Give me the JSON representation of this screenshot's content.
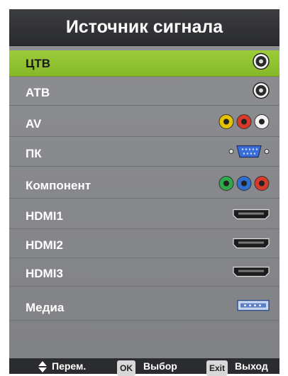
{
  "title": "Источник сигнала",
  "items": [
    {
      "label": "ЦТВ",
      "icon": "antenna-jack-icon",
      "selected": true
    },
    {
      "label": "АТВ",
      "icon": "antenna-jack-icon"
    },
    {
      "label": "AV",
      "icon": "rca-jacks-icon",
      "colors": [
        "#e6c200",
        "#d73a2a",
        "#f2f2f2"
      ]
    },
    {
      "label": "ПК",
      "icon": "vga-port-icon"
    },
    {
      "label": "Компонент",
      "icon": "component-jacks-icon",
      "colors": [
        "#2fa84a",
        "#2f6fd0",
        "#d73a2a"
      ]
    },
    {
      "label": "HDMI1",
      "icon": "hdmi-port-icon"
    },
    {
      "label": "HDMI2",
      "icon": "hdmi-port-icon"
    },
    {
      "label": "HDMI3",
      "icon": "hdmi-port-icon"
    },
    {
      "label": "Медиа",
      "icon": "usb-port-icon"
    }
  ],
  "footer": {
    "move_label": "Перем.",
    "ok_key": "OK",
    "select_label": "Выбор",
    "exit_key": "Exit",
    "exit_label": "Выход"
  },
  "colors": {
    "selected": "#94c634",
    "panel": "#8a8b8e",
    "title_bg": "#333437"
  }
}
